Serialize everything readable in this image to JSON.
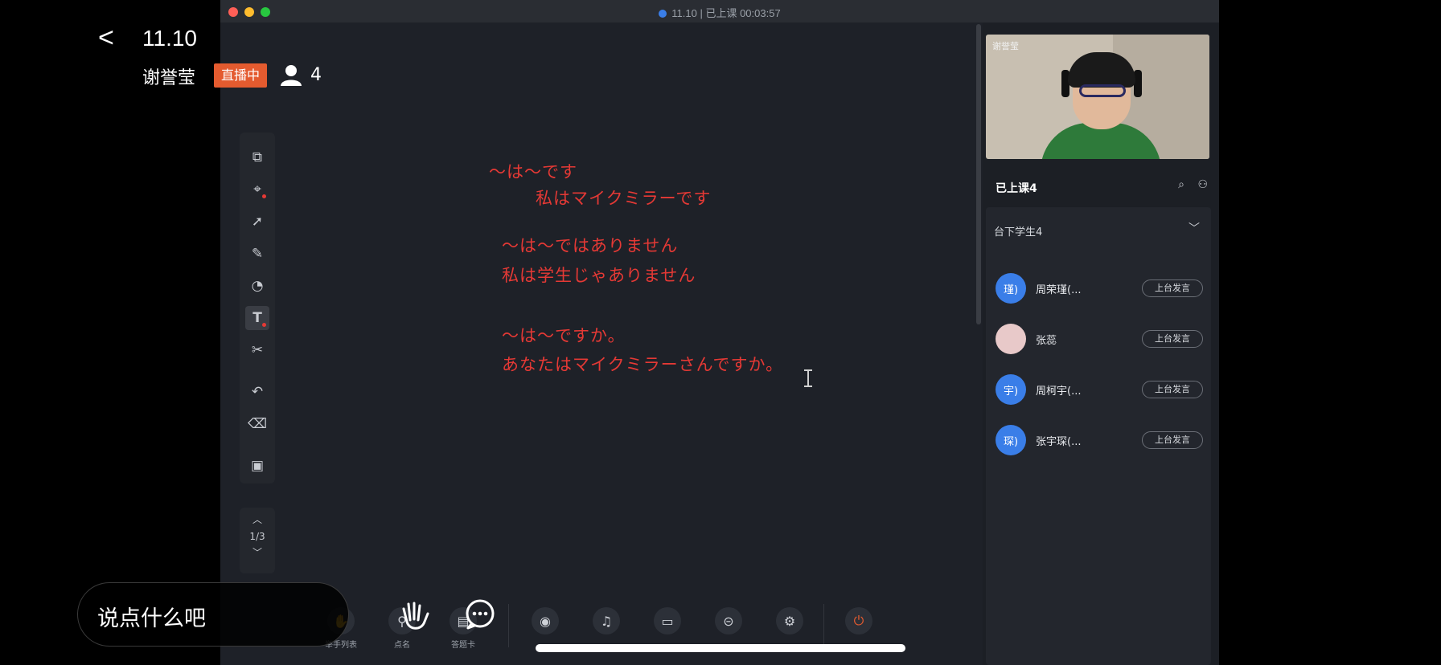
{
  "overlay": {
    "title": "11.10",
    "teacher_name": "谢誉莹",
    "live_badge": "直播中",
    "viewer_count": "4",
    "chat_placeholder": "说点什么吧"
  },
  "window": {
    "title": "11.10 | 已上课 00:03:57"
  },
  "whiteboard": {
    "lines": [
      "～は～です",
      "私はマイクミラーです",
      "～は～ではありません",
      "私は学生じゃありません",
      "～は～ですか。",
      "あなたはマイクミラーさんですか。"
    ],
    "page": "1/3"
  },
  "right_panel": {
    "video_label": "谢誉莹",
    "header": "已上课4",
    "students_title": "台下学生4",
    "students": [
      {
        "avatar": "瑾)",
        "name": "周荣瑾(...",
        "button": "上台发言"
      },
      {
        "avatar": "",
        "name": "张蕊",
        "button": "上台发言"
      },
      {
        "avatar": "宇)",
        "name": "周柯宇(...",
        "button": "上台发言"
      },
      {
        "avatar": "琛)",
        "name": "张宇琛(...",
        "button": "上台发言"
      }
    ]
  },
  "bottom_toolbar": {
    "labels": [
      "举手列表",
      "点名",
      "答题卡"
    ]
  },
  "colors": {
    "ink_red": "#e53935",
    "live_orange": "#e45b2f",
    "avatar_blue": "#3a7ee8"
  }
}
